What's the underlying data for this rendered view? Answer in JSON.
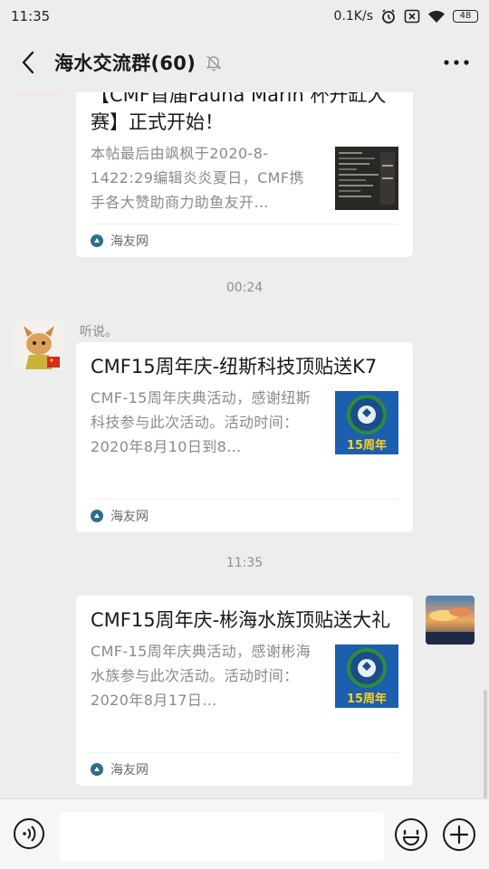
{
  "status_bar": {
    "time": "11:35",
    "network_speed": "0.1K/s",
    "battery": "48"
  },
  "header": {
    "title": "海水交流群(60)"
  },
  "messages": [
    {
      "type": "link_card",
      "title": "【CMF首届Fauna Marin 杯开缸大赛】正式开始！",
      "description": "本帖最后由飒枫于2020-8-1422:29编辑炎炎夏日，CMF携手各大赞助商力助鱼友开…",
      "source": "海友网",
      "thumb_icon": "screenshot-thumbnail"
    },
    {
      "type": "time",
      "text": "00:24"
    },
    {
      "type": "link_card",
      "sender_name": "听说。",
      "title": "CMF15周年庆-纽斯科技顶贴送K7",
      "description": "CMF-15周年庆典活动，感谢纽斯科技参与此次活动。活动时间：2020年8月10日到8…",
      "source": "海友网",
      "thumb_label": "15周年"
    },
    {
      "type": "time",
      "text": "11:35"
    },
    {
      "type": "link_card",
      "title": "CMF15周年庆-彬海水族顶贴送大礼",
      "description": "CMF-15周年庆典活动，感谢彬海水族参与此次活动。活动时间：2020年8月17日…",
      "source": "海友网",
      "thumb_label": "15周年"
    }
  ],
  "colors": {
    "background": "#ededed",
    "card": "#ffffff",
    "thumb_blue": "#1f5fb0",
    "thumb_ring": "#2e8b3a",
    "thumb_text": "#ffd21f"
  }
}
